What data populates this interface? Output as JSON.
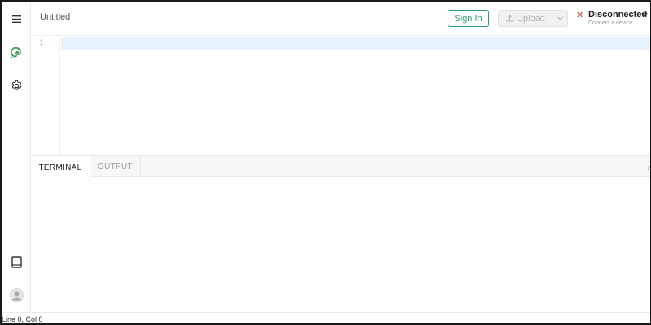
{
  "header": {
    "title": "Untitled",
    "sign_in_label": "Sign In",
    "upload_label": "Upload",
    "upload_icon": "upload-icon",
    "status_icon": "close-icon",
    "status": "Disconnected",
    "status_hint": "Connect a device"
  },
  "sidebar": {
    "items": [
      {
        "icon": "menu-icon"
      },
      {
        "icon": "chameleon-logo-icon"
      },
      {
        "icon": "gear-icon"
      },
      {
        "icon": "book-icon"
      },
      {
        "icon": "user-avatar-icon"
      }
    ]
  },
  "editor": {
    "line_numbers": [
      "1"
    ]
  },
  "panel": {
    "tabs": [
      {
        "label": "TERMINAL",
        "active": true
      },
      {
        "label": "OUTPUT",
        "active": false
      }
    ],
    "collapse_glyph": "›"
  },
  "statusbar": {
    "cursor": "Line 0, Col 0"
  },
  "colors": {
    "accent": "#2e9d68",
    "disconnected": "#d32f2f",
    "active_line": "#e8f2fc"
  }
}
